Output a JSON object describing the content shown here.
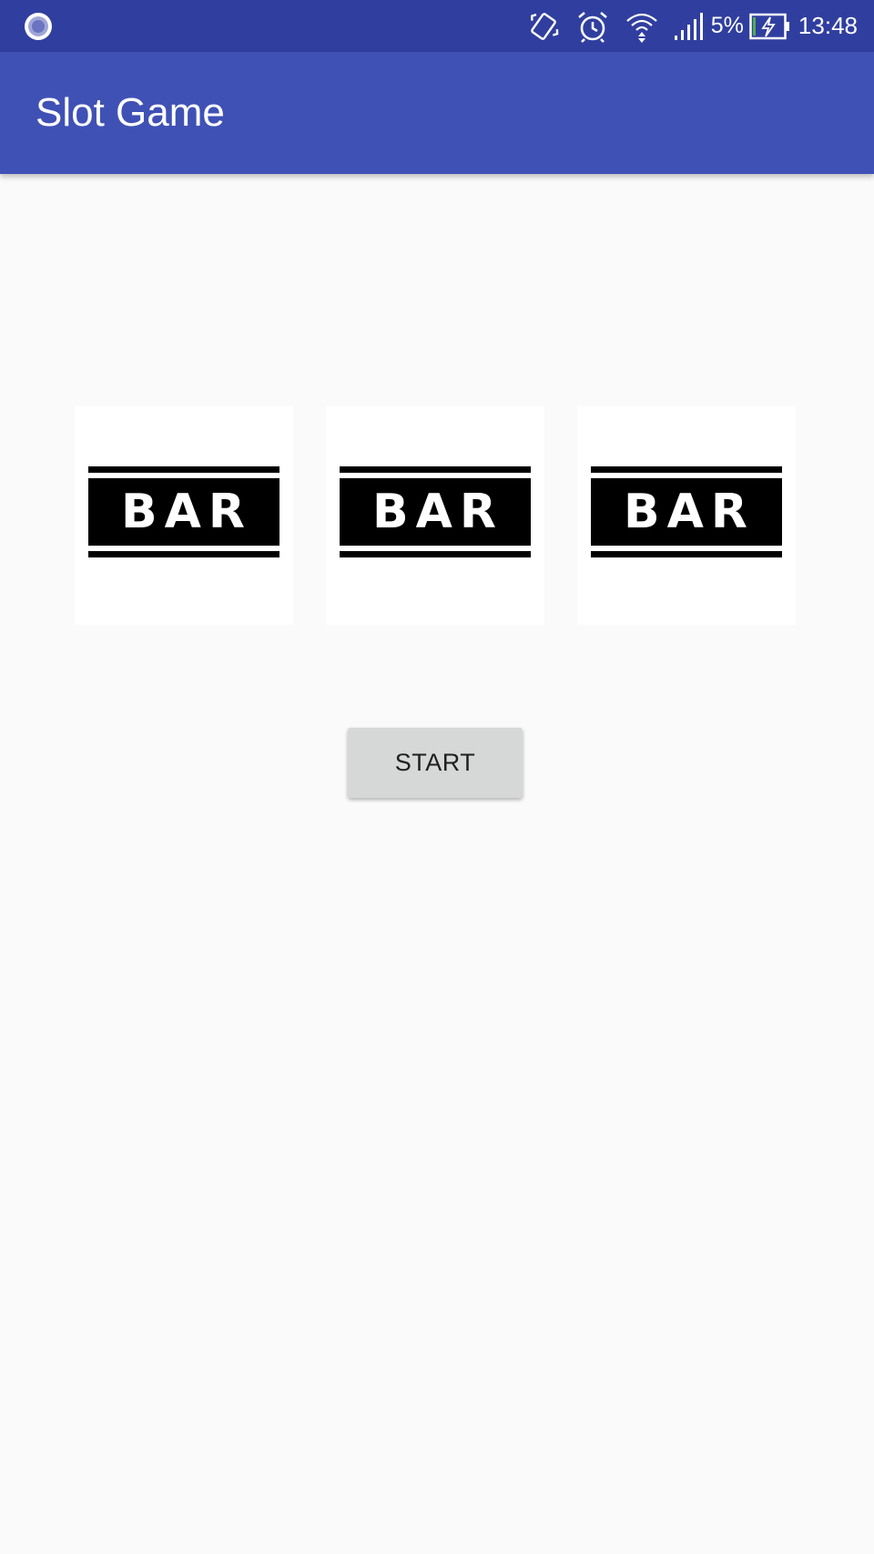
{
  "status_bar": {
    "left_icon": "record-circle-icon",
    "icons": [
      "vibrate-icon",
      "alarm-icon",
      "wifi-icon",
      "cell-signal-icon"
    ],
    "battery_percent": "5%",
    "battery_icon": "battery-charging-icon",
    "time": "13:48"
  },
  "app_bar": {
    "title": "Slot Game"
  },
  "reels": [
    {
      "symbol": "BAR"
    },
    {
      "symbol": "BAR"
    },
    {
      "symbol": "BAR"
    }
  ],
  "start_button": {
    "label": "START"
  },
  "colors": {
    "status_bar": "#303f9f",
    "app_bar": "#3f51b5",
    "background": "#fafafa",
    "button": "#d6d7d7"
  }
}
